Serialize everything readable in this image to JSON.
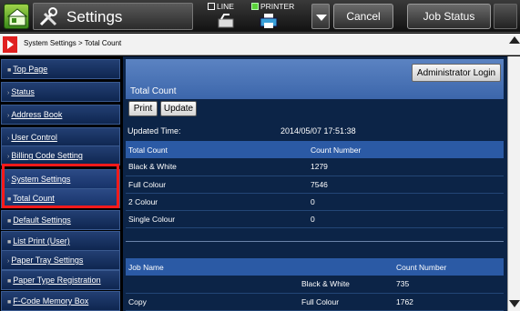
{
  "app": {
    "title": "Settings"
  },
  "status": {
    "line": "LINE",
    "printer": "PRINTER"
  },
  "topbar": {
    "cancel": "Cancel",
    "job_status": "Job Status"
  },
  "breadcrumb": "System Settings > Total Count",
  "sidebar": {
    "items": [
      {
        "label": "Top Page",
        "marker": "■"
      },
      {
        "label": "Status",
        "marker": "›"
      },
      {
        "label": "Address Book",
        "marker": "›"
      },
      {
        "label": "User Control",
        "marker": "›"
      },
      {
        "label": "Billing Code Setting",
        "marker": "›"
      },
      {
        "label": "System Settings",
        "marker": "›"
      },
      {
        "label": "Total Count",
        "marker": "■"
      },
      {
        "label": "Default Settings",
        "marker": "■"
      },
      {
        "label": "List Print (User)",
        "marker": "■"
      },
      {
        "label": "Paper Tray Settings",
        "marker": "›"
      },
      {
        "label": "Paper Type Registration",
        "marker": "■"
      },
      {
        "label": "F-Code Memory Box",
        "marker": "■"
      }
    ]
  },
  "panel": {
    "admin_login": "Administrator Login",
    "title": "Total Count",
    "print": "Print",
    "update": "Update",
    "updated_label": "Updated Time:",
    "updated_value": "2014/05/07 17:51:38"
  },
  "total_table": {
    "headers": [
      "Total Count",
      "Count Number"
    ],
    "rows": [
      [
        "Black & White",
        "1279"
      ],
      [
        "Full Colour",
        "7546"
      ],
      [
        "2 Colour",
        "0"
      ],
      [
        "Single Colour",
        "0"
      ]
    ]
  },
  "job_table": {
    "headers": [
      "Job Name",
      "",
      "Count Number"
    ],
    "rows": [
      [
        "",
        "Black & White",
        "735"
      ],
      [
        "Copy",
        "Full Colour",
        "1762"
      ]
    ]
  }
}
